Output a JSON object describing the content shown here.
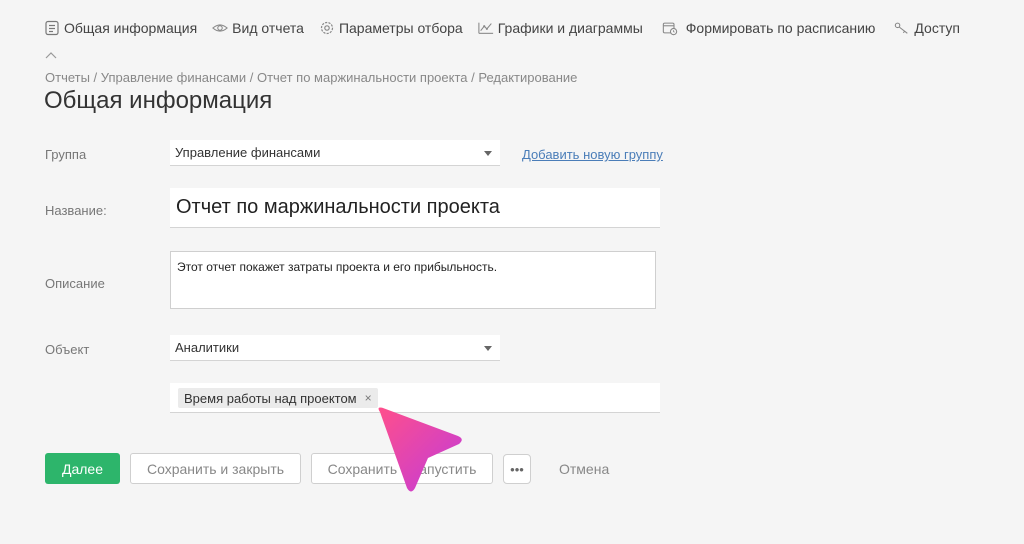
{
  "tabs": [
    {
      "label": "Общая информация",
      "icon": "document-list-icon",
      "active": true
    },
    {
      "label": "Вид отчета",
      "icon": "eye-icon"
    },
    {
      "label": "Параметры отбора",
      "icon": "gear-icon"
    },
    {
      "label": "Графики и диаграммы",
      "icon": "line-chart-icon"
    },
    {
      "label": "Формировать по расписанию",
      "icon": "calendar-clock-icon"
    },
    {
      "label": "Доступ",
      "icon": "key-icon"
    }
  ],
  "breadcrumb": "Отчеты / Управление финансами / Отчет по маржинальности проекта / Редактирование",
  "title": "Общая информация",
  "form": {
    "group_label": "Группа",
    "group_value": "Управление финансами",
    "add_group_link": "Добавить новую группу",
    "name_label": "Название:",
    "name_value": "Отчет по маржинальности проекта",
    "description_label": "Описание",
    "description_value": "Этот отчет покажет затраты проекта и его прибыльность.",
    "object_label": "Объект",
    "object_value": "Аналитики",
    "tags": [
      {
        "label": "Время работы над проектом",
        "remove": "×"
      }
    ]
  },
  "buttons": {
    "next": "Далее",
    "save_close": "Сохранить и закрыть",
    "save_run": "Сохранить и запустить",
    "more": "•••",
    "cancel": "Отмена"
  },
  "colors": {
    "primary": "#2db56b",
    "link": "#4a7db8",
    "cursor_start": "#ff4f8b",
    "cursor_end": "#c13bdb"
  }
}
